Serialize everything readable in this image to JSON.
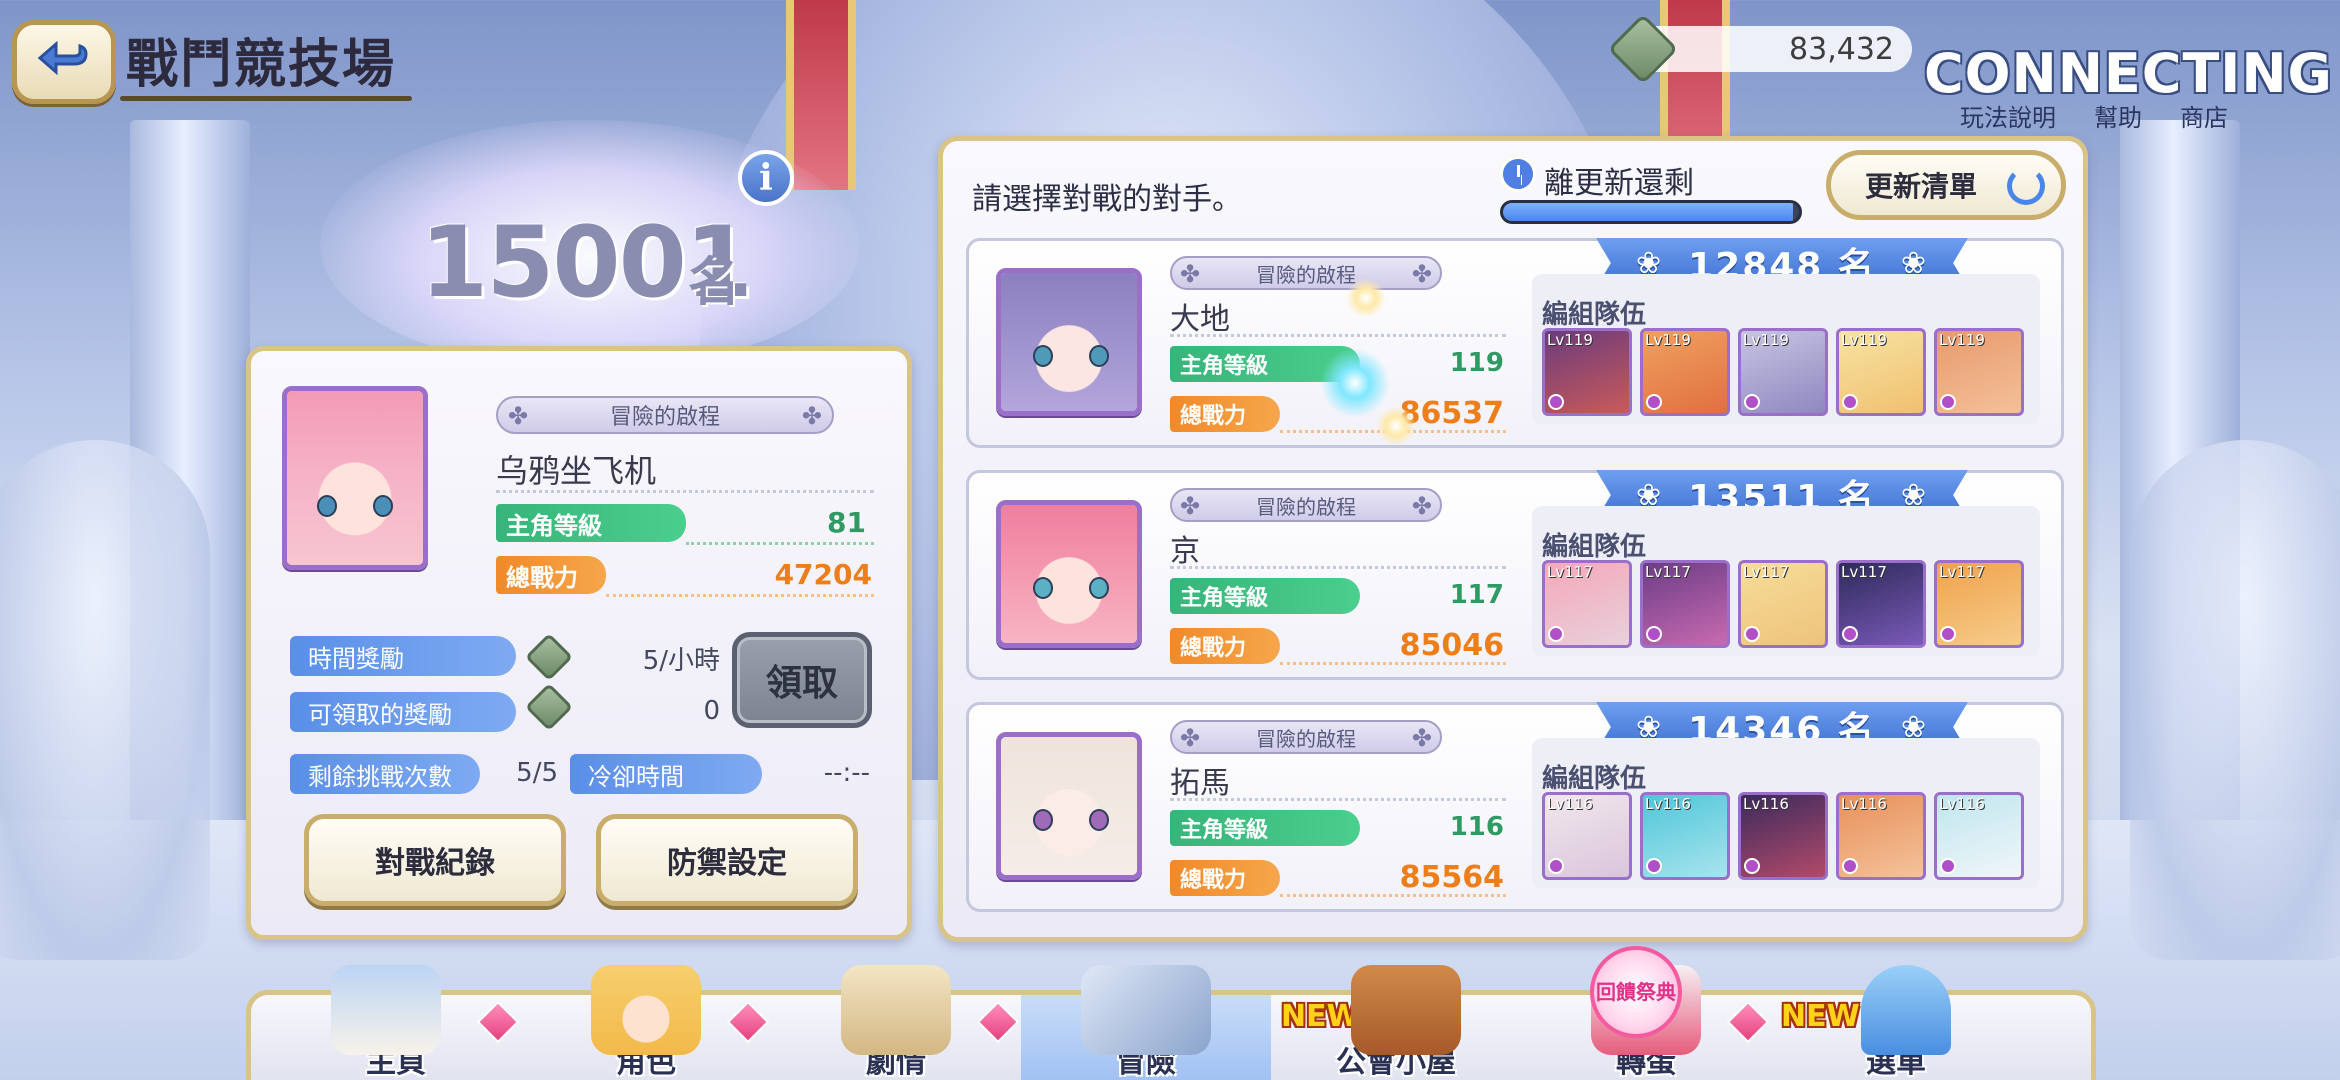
{
  "header": {
    "title": "戰鬥競技場",
    "coins": "83,432",
    "connecting": "CONNECTING",
    "links": [
      "玩法說明",
      "幫助",
      "商店"
    ]
  },
  "player": {
    "rank_number": "15001",
    "rank_unit": "名",
    "subtitle": "冒險的啟程",
    "name": "乌鸦坐飞机",
    "level_label": "主角等級",
    "level": "81",
    "power_label": "總戰力",
    "power": "47204",
    "time_reward_label": "時間獎勵",
    "time_reward_value": "5/小時",
    "claimable_label": "可領取的獎勵",
    "claimable_value": "0",
    "claim_button": "領取",
    "challenges_label": "剩餘挑戰次數",
    "challenges_value": "5/5",
    "cooldown_label": "冷卻時間",
    "cooldown_value": "--:--",
    "history_button": "對戰紀錄",
    "defense_button": "防禦設定"
  },
  "opponents_panel": {
    "heading": "請選擇對戰的對手。",
    "timer_label": "離更新還剩",
    "timer_progress": 0.98,
    "refresh_button": "更新清單",
    "team_label": "編組隊伍",
    "opponents": [
      {
        "rank": "12848 名",
        "subtitle": "冒險的啟程",
        "name": "大地",
        "level_label": "主角等級",
        "level": "119",
        "power_label": "總戰力",
        "power": "86537",
        "team_levels": [
          "Lv119",
          "Lv119",
          "Lv119",
          "Lv119",
          "Lv119"
        ]
      },
      {
        "rank": "13511 名",
        "subtitle": "冒險的啟程",
        "name": "京",
        "level_label": "主角等級",
        "level": "117",
        "power_label": "總戰力",
        "power": "85046",
        "team_levels": [
          "Lv117",
          "Lv117",
          "Lv117",
          "Lv117",
          "Lv117"
        ]
      },
      {
        "rank": "14346 名",
        "subtitle": "冒險的啟程",
        "name": "拓馬",
        "level_label": "主角等級",
        "level": "116",
        "power_label": "總戰力",
        "power": "85564",
        "team_levels": [
          "Lv116",
          "Lv116",
          "Lv116",
          "Lv116",
          "Lv116"
        ]
      }
    ]
  },
  "nav": {
    "items": [
      "主頁",
      "角色",
      "劇情",
      "冒險",
      "公會小屋",
      "轉蛋",
      "選單"
    ],
    "active": "冒險",
    "new_badge": "NEW",
    "event_badge": "回饋祭典"
  },
  "colors": {
    "accent_blue": "#4a86ea",
    "level_green": "#37b47a",
    "power_orange": "#f08a2a",
    "frame_gold": "#d9c488",
    "portrait_purple": "#9a6fc9"
  }
}
